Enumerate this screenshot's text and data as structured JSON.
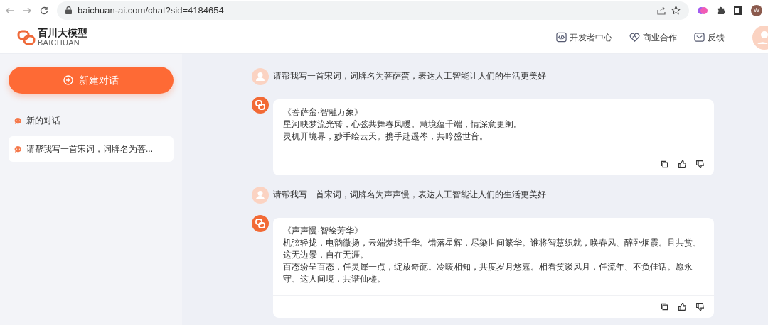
{
  "browser": {
    "url": "baichuan-ai.com/chat?sid=4184654",
    "profile_initial": "W"
  },
  "header": {
    "logo_title": "百川大模型",
    "logo_subtitle": "BAICHUAN",
    "nav": [
      {
        "kind": "code",
        "label": "开发者中心"
      },
      {
        "kind": "heart",
        "label": "商业合作"
      },
      {
        "kind": "mail",
        "label": "反馈"
      }
    ]
  },
  "sidebar": {
    "new_chat": "新建对话",
    "items": [
      {
        "label": "新的对话",
        "selected": false
      },
      {
        "label": "请帮我写一首宋词，词牌名为菩...",
        "selected": true
      }
    ]
  },
  "messages": [
    {
      "kind": "user",
      "text": "请帮我写一首宋词，词牌名为菩萨蛮，表达人工智能让人们的生活更美好"
    },
    {
      "kind": "bot",
      "paragraphs": [
        "《菩萨蛮·智融万象》",
        "星河映梦流光转，心弦共舞春风暖。慧境蕴千端，情深意更阑。",
        "灵机开境界，妙手绘云天。携手赴遥岑，共吟盛世音。"
      ]
    },
    {
      "kind": "user",
      "text": "请帮我写一首宋词，词牌名为声声慢，表达人工智能让人们的生活更美好"
    },
    {
      "kind": "bot",
      "paragraphs": [
        "《声声慢·智绘芳华》",
        "机弦轻拢，电韵微扬，云端梦绕千华。错落星辉，尽染世间繁华。谁将智慧织就，唤春风、醉卧烟霞。且共赏、这无边景，自在无涯。",
        "百态纷呈百态，任灵犀一点，绽放奇葩。冷暖相知，共度岁月悠嘉。相看笑谈风月，任流年、不负佳话。愿永守、这人间境，共谱仙槎。"
      ]
    }
  ]
}
